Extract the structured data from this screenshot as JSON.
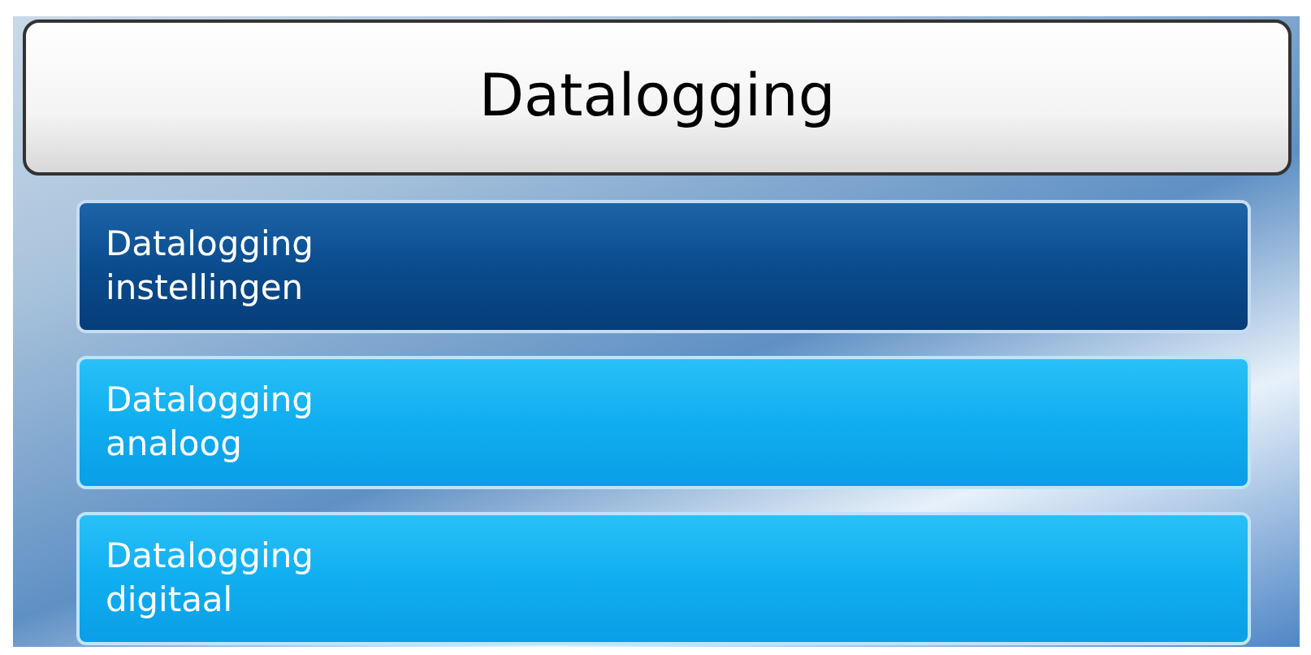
{
  "title": "Datalogging",
  "menu": [
    {
      "line1": "Datalogging",
      "line2": "instellingen",
      "selected": true
    },
    {
      "line1": "Datalogging",
      "line2": "analoog",
      "selected": false
    },
    {
      "line1": "Datalogging",
      "line2": "digitaal",
      "selected": false
    }
  ]
}
